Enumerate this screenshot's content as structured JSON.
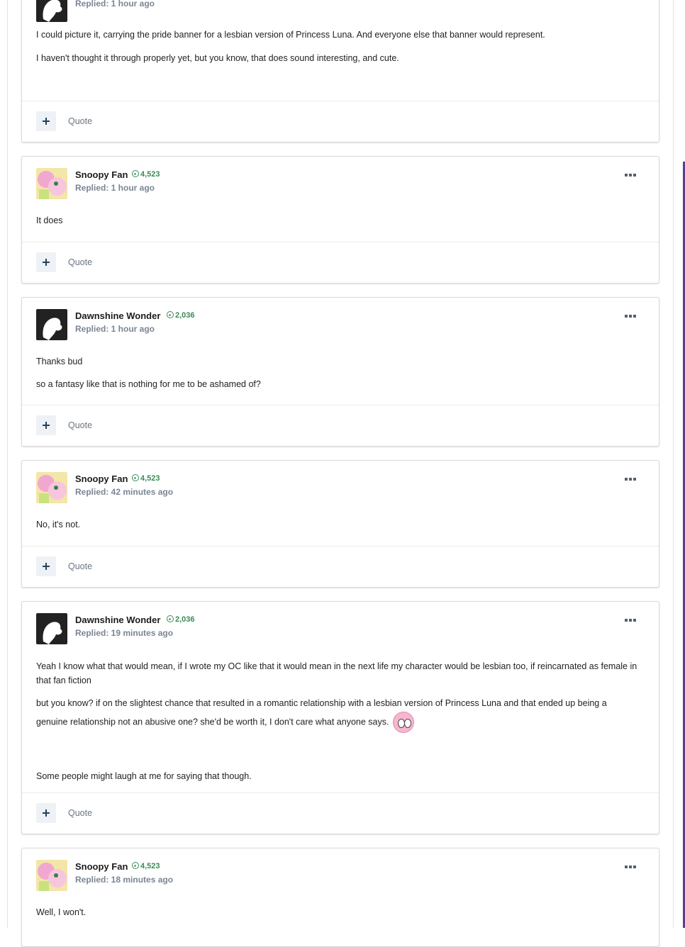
{
  "posts": [
    {
      "author": "",
      "replied": "Replied: 1 hour ago",
      "paragraphs": [
        "I could picture it, carrying the pride banner for a lesbian version of Princess Luna. And everyone else that banner would represent.",
        "I haven't thought it through properly yet, but you know, that does sound interesting, and cute."
      ],
      "quote_label": "Quote"
    },
    {
      "author": "Snoopy Fan",
      "reputation": "4,523",
      "replied": "Replied: 1 hour ago",
      "paragraphs": [
        "It does"
      ],
      "quote_label": "Quote"
    },
    {
      "author": "Dawnshine Wonder",
      "reputation": "2,036",
      "replied": "Replied: 1 hour ago",
      "paragraphs": [
        "Thanks bud",
        "so a fantasy like that is nothing for me to be ashamed of?"
      ],
      "quote_label": "Quote"
    },
    {
      "author": "Snoopy Fan",
      "reputation": "4,523",
      "replied": "Replied: 42 minutes ago",
      "paragraphs": [
        "No, it's not."
      ],
      "quote_label": "Quote"
    },
    {
      "author": "Dawnshine Wonder",
      "reputation": "2,036",
      "replied": "Replied: 19 minutes ago",
      "paragraphs": [
        "Yeah I know what that would mean, if I wrote my OC like that it would mean in the next life my character would be lesbian too, if reincarnated as female in that fan fiction",
        "but you know? if on the slightest chance that resulted in a romantic relationship with a lesbian version of Princess Luna and that ended up being a",
        "genuine relationship not an abusive one? she'd be worth it, I don't care what anyone says.",
        "Some people might laugh at me for saying that though."
      ],
      "emoji": "pony-emoji",
      "quote_label": "Quote"
    },
    {
      "author": "Snoopy Fan",
      "reputation": "4,523",
      "replied": "Replied: 18 minutes ago",
      "paragraphs": [
        "Well, I won't."
      ]
    }
  ],
  "icons": {
    "reputation": "plus-circle-icon",
    "menu": "ellipsis-icon",
    "multiquote": "plus-icon"
  },
  "colors": {
    "reputation": "#3a8a55",
    "replied": "#7a8593",
    "accent": "#5c3f8a"
  }
}
